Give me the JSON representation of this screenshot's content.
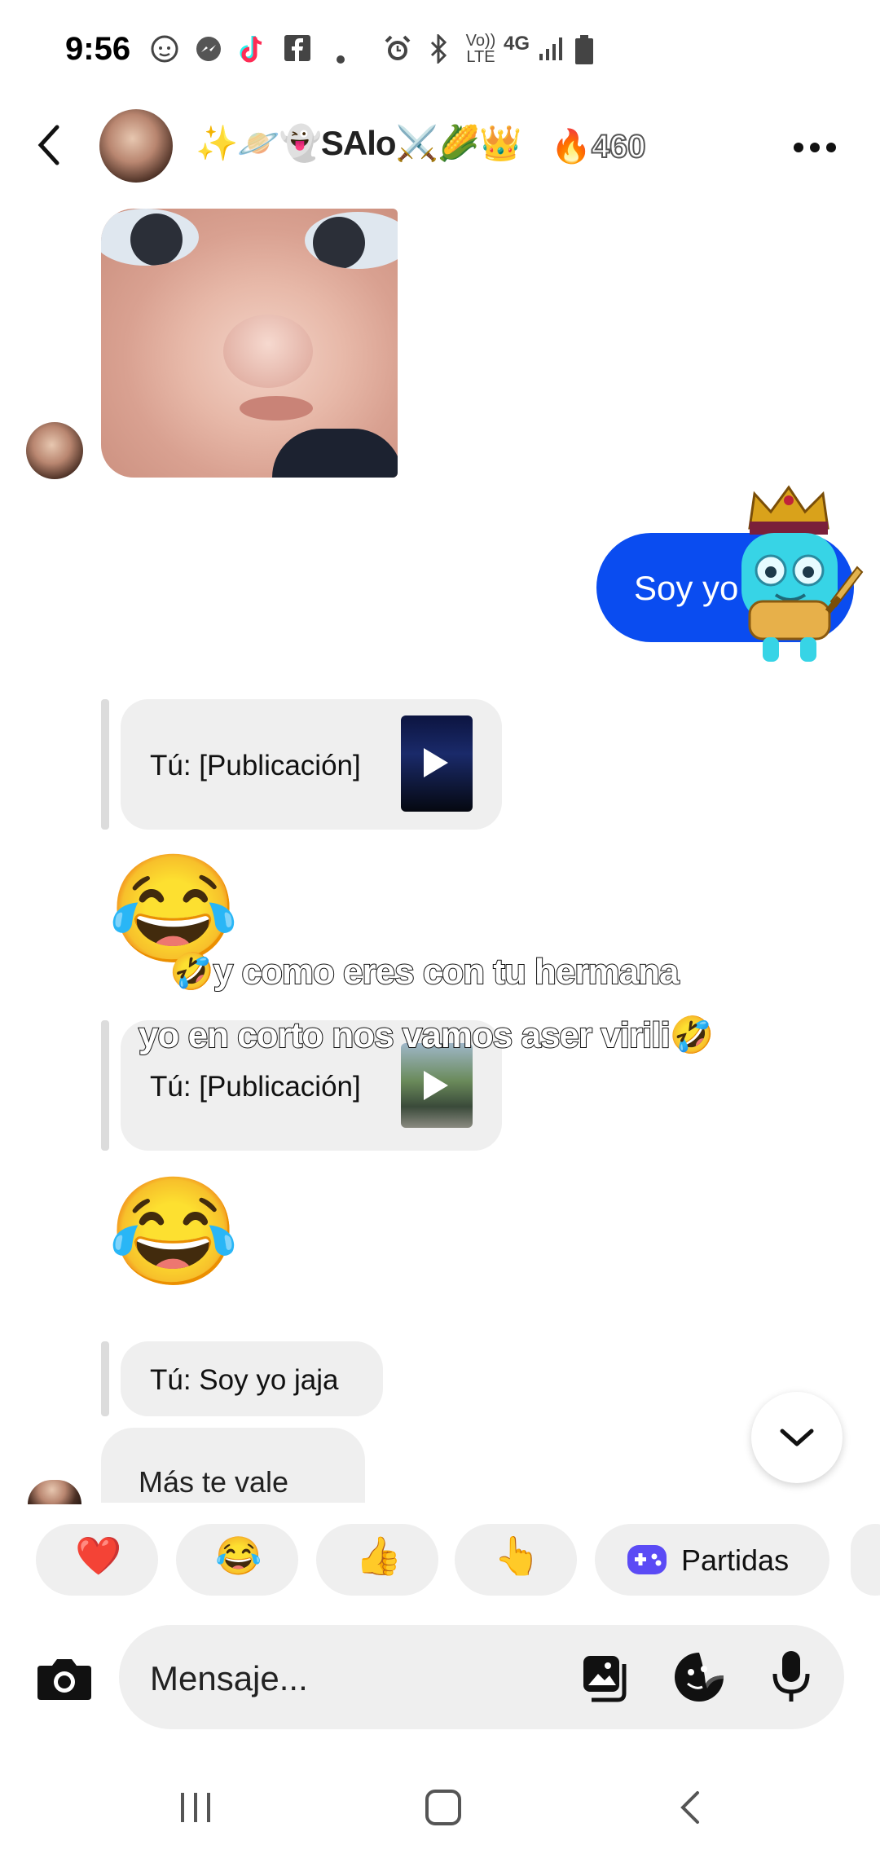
{
  "status_bar": {
    "time": "9:56",
    "icons": [
      "baby-icon",
      "messenger-icon",
      "tiktok-icon",
      "facebook-icon",
      "dot-icon",
      "alarm-icon",
      "bluetooth-icon",
      "volte-icon",
      "4g-icon",
      "signal-icon",
      "battery-icon"
    ],
    "volte_label": "Vo)) LTE",
    "network_label": "4G"
  },
  "header": {
    "title": "✨🪐👻SAlo⚔️🌽👑",
    "streak_emoji": "🔥",
    "streak_count": "460"
  },
  "messages": {
    "outgoing_text": "Soy yo",
    "reply_1": {
      "text": "Tú: [Publicación]"
    },
    "emoji_1": "😂",
    "caption_line_1": "🤣y como eres con tu hermana",
    "caption_line_2": "yo en corto nos vamos aser  virili🤣",
    "reply_2": {
      "text": "Tú: [Publicación]"
    },
    "emoji_2": "😂",
    "reply_3": {
      "text": "Tú: Soy yo jaja"
    },
    "incoming_text": "Más te vale"
  },
  "quick_reactions": {
    "heart": "❤️",
    "laugh": "😂",
    "thumbs_up": "👍",
    "pointing": "👆",
    "partidas_label": "Partidas"
  },
  "composer": {
    "placeholder": "Mensaje..."
  },
  "colors": {
    "outgoing_bubble": "#0a4cf0",
    "bubble_gray": "#efefef",
    "games_icon": "#5b4bf5"
  }
}
